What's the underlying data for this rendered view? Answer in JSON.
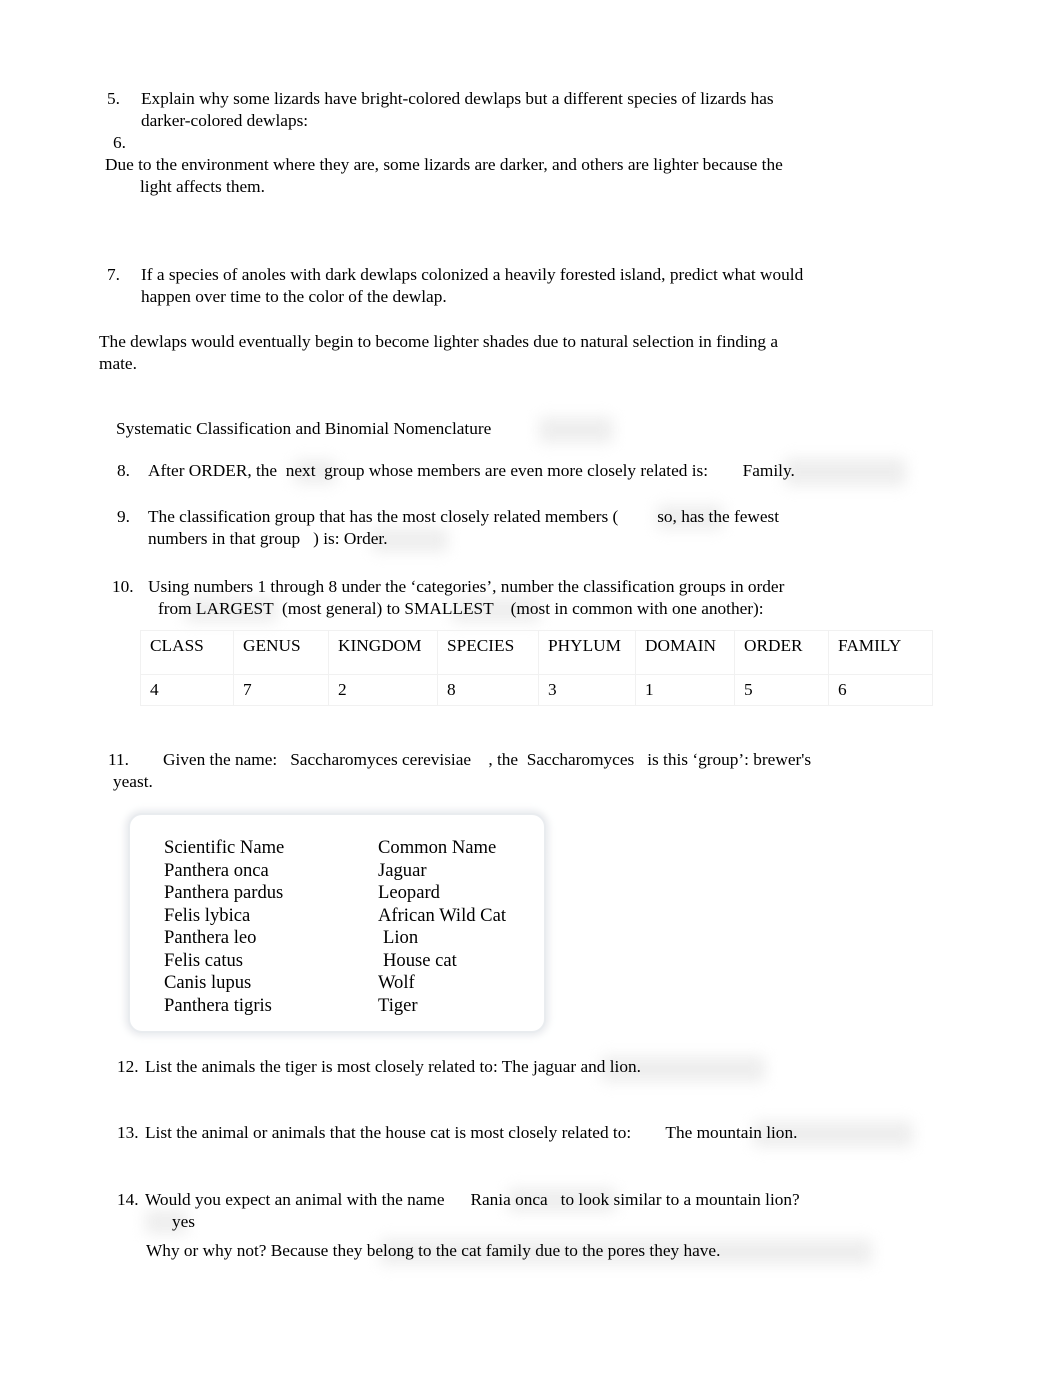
{
  "document": {
    "type": "biology-worksheet",
    "font_color": "#000000",
    "background": "#ffffff",
    "shade_color": "#ebebeb"
  },
  "q5": {
    "number": "5.",
    "line1": "Explain why some lizards have bright-colored dewlaps but a different species of lizards has",
    "line2": "darker-colored dewlaps:"
  },
  "q6": {
    "number": "6.",
    "answer_line1": "Due to the environment where they are, some lizards are darker, and others are lighter because the",
    "answer_line2": "light affects them."
  },
  "q7": {
    "number": "7.",
    "line1": "If a species of anoles with dark dewlaps colonized a heavily forested island, predict what would",
    "line2": "happen over time to the color of the dewlap.",
    "answer_line1": "The dewlaps would eventually begin to become lighter shades due to natural selection in finding a",
    "answer_line2": "mate."
  },
  "section": {
    "heading": "Systematic Classification and Binomial Nomenclature"
  },
  "q8": {
    "number": "8.",
    "text_a": "After ORDER, the",
    "blank_a": "next",
    "text_b": "group whose members are even more closely related is:",
    "answer": "Family."
  },
  "q9": {
    "number": "9.",
    "line1_a": "The classification group that has the most closely related members (",
    "line1_b": "so, has the fewest",
    "line2_a": "numbers in that group",
    "line2_b": ") is: Order."
  },
  "q10": {
    "number": "10.",
    "line1": "Using numbers 1 through 8 under the ‘categories’, number the classification groups in order",
    "line2_a": "from LARGEST",
    "line2_b": "(most general) to SMALLEST",
    "line2_c": "(most in common with one another):"
  },
  "classification_table": {
    "headers": [
      "CLASS",
      "GENUS",
      "KINGDOM",
      "SPECIES",
      "PHYLUM",
      "DOMAIN",
      "ORDER",
      "FAMILY"
    ],
    "values": [
      "4",
      "7",
      "2",
      "8",
      "3",
      "1",
      "5",
      "6"
    ],
    "border_color": "#f1f1f1"
  },
  "q11": {
    "number": "11.",
    "text_a": "Given the name:",
    "name_a": "Saccharomyces cerevisiae",
    "text_b": ", the",
    "name_b": "Saccharomyces",
    "text_c": "is this ‘group’: brewer's",
    "line2": "yeast."
  },
  "names_box": {
    "header": {
      "scientific": "Scientific Name",
      "common": "Common Name"
    },
    "rows": [
      {
        "scientific": "Panthera onca",
        "common": "Jaguar",
        "indent": false
      },
      {
        "scientific": "Panthera pardus",
        "common": "Leopard",
        "indent": false
      },
      {
        "scientific": "Felis lybica",
        "common": "African Wild Cat",
        "indent": false
      },
      {
        "scientific": "Panthera leo",
        "common": "Lion",
        "indent": true
      },
      {
        "scientific": "Felis catus",
        "common": "House cat",
        "indent": true
      },
      {
        "scientific": "Canis lupus",
        "common": "Wolf",
        "indent": false
      },
      {
        "scientific": "Panthera tigris",
        "common": "Tiger",
        "indent": false
      }
    ]
  },
  "q12": {
    "number": "12.",
    "text": "List the animals the tiger is most closely related to: The jaguar and lion."
  },
  "q13": {
    "number": "13.",
    "text": "List the animal or animals that the house cat is most closely related to:",
    "answer": "The mountain lion."
  },
  "q14": {
    "number": "14.",
    "text_a": "Would you expect an animal with the name",
    "name": "Rania onca",
    "text_b": "to look similar to a mountain lion?",
    "answer_line2": "yes",
    "followup": "Why or why not? Because they belong to the cat family due to the pores they have."
  }
}
